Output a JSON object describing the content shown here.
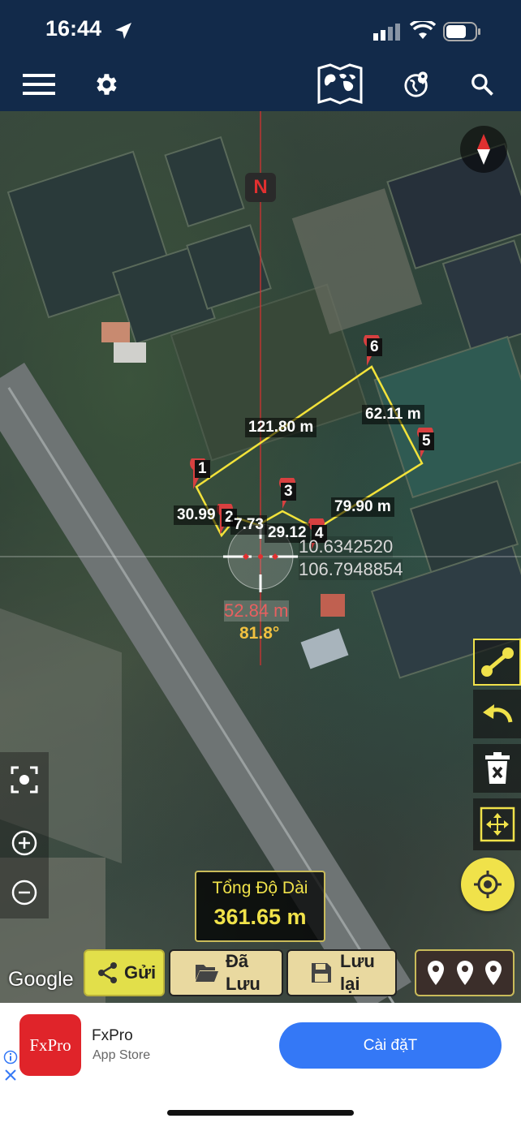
{
  "status_bar": {
    "time": "16:44"
  },
  "map": {
    "north_label": "N",
    "segments": [
      "121.80 m",
      "62.11 m",
      "79.90 m",
      "30.99",
      "7.73",
      "29.12"
    ],
    "markers": [
      "1",
      "2",
      "3",
      "4",
      "5",
      "6"
    ],
    "coordinates": {
      "lat": "10.6342520",
      "lon": "106.7948854"
    },
    "cursor_distance": "52.84 m",
    "cursor_angle": "81.8°",
    "google_logo": "Google"
  },
  "total": {
    "label": "Tổng Độ Dài",
    "value": "361.65 m"
  },
  "buttons": {
    "send": "Gửi",
    "saved": "Đã Lưu",
    "save": "Lưu lại"
  },
  "ad": {
    "logo": "FxPro",
    "name": "FxPro",
    "store": "App Store",
    "install": "Cài đặT"
  },
  "colors": {
    "navy": "#122a4a",
    "accent_yellow": "#f0e24a",
    "button_tan": "#e9d9a0",
    "ad_blue": "#3478f6"
  }
}
